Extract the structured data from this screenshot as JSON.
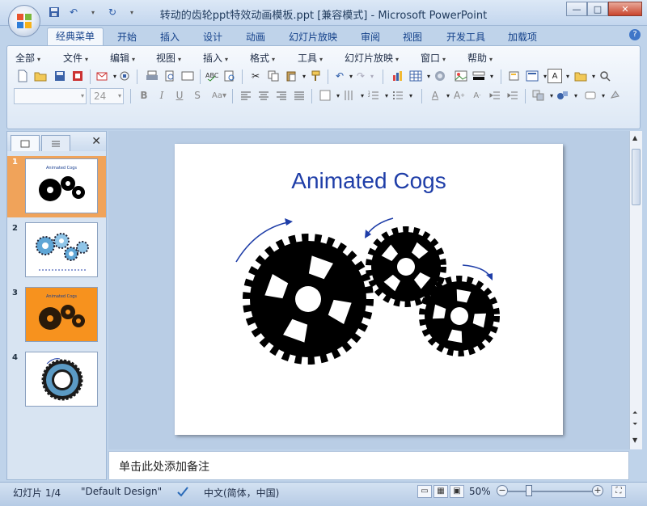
{
  "window": {
    "title": "转动的齿轮ppt特效动画模板.ppt [兼容模式] - Microsoft PowerPoint",
    "minimize": "—",
    "maximize": "□",
    "close": "✕"
  },
  "tabs": [
    "经典菜单",
    "开始",
    "插入",
    "设计",
    "动画",
    "幻灯片放映",
    "审阅",
    "视图",
    "开发工具",
    "加载项"
  ],
  "menus": [
    "全部",
    "文件",
    "编辑",
    "视图",
    "插入",
    "格式",
    "工具",
    "幻灯片放映",
    "窗口",
    "帮助"
  ],
  "toolbar": {
    "font_name": "",
    "font_size": "24"
  },
  "slides_pane": {
    "thumbnails": [
      {
        "number": "1",
        "title": "Animated Cogs"
      },
      {
        "number": "2",
        "title": ""
      },
      {
        "number": "3",
        "title": "Animated Cogs"
      },
      {
        "number": "4",
        "title": ""
      }
    ]
  },
  "slide": {
    "title": "Animated Cogs"
  },
  "notes": {
    "placeholder": "单击此处添加备注"
  },
  "status": {
    "slide_counter": "幻灯片 1/4",
    "theme": "\"Default Design\"",
    "language": "中文(简体，中国)",
    "zoom": "50%"
  },
  "colors": {
    "title_blue": "#1f3ea8",
    "selected_thumb": "#f0a35a",
    "thumb3_bg": "#f7921e",
    "cog": "#000000",
    "arrow": "#1f3ea8"
  }
}
